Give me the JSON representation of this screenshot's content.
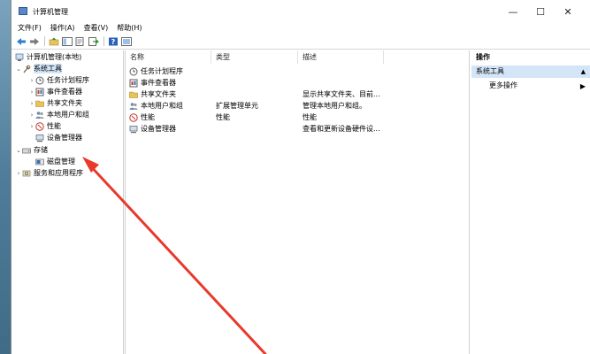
{
  "window": {
    "title": "计算机管理",
    "minimize": "—",
    "maximize": "☐",
    "close": "✕"
  },
  "menu": [
    "文件(F)",
    "操作(A)",
    "查看(V)",
    "帮助(H)"
  ],
  "tree": {
    "root": "计算机管理(本地)",
    "system_tools": "系统工具",
    "task_scheduler": "任务计划程序",
    "event_viewer": "事件查看器",
    "shared_folders": "共享文件夹",
    "local_users": "本地用户和组",
    "performance": "性能",
    "device_manager": "设备管理器",
    "storage": "存储",
    "disk_management": "磁盘管理",
    "services": "服务和应用程序"
  },
  "list": {
    "columns": [
      "名称",
      "类型",
      "描述"
    ],
    "rows": [
      {
        "name": "任务计划程序",
        "type": "",
        "desc": "",
        "icon": "clock-icon"
      },
      {
        "name": "事件查看器",
        "type": "",
        "desc": "",
        "icon": "event-viewer-icon"
      },
      {
        "name": "共享文件夹",
        "type": "",
        "desc": "显示共享文件夹、目前...",
        "icon": "folder-icon"
      },
      {
        "name": "本地用户和组",
        "type": "扩展管理单元",
        "desc": "管理本地用户和组。",
        "icon": "users-icon"
      },
      {
        "name": "性能",
        "type": "性能",
        "desc": "性能",
        "icon": "performance-icon"
      },
      {
        "name": "设备管理器",
        "type": "",
        "desc": "查看和更新设备硬件设...",
        "icon": "device-manager-icon"
      }
    ]
  },
  "actions": {
    "header": "操作",
    "selected": "系统工具",
    "more": "更多操作",
    "up": "▲",
    "more_arrow": "▶"
  },
  "colors": {
    "selection": "#d3e5f7",
    "arrow": "#e8392b"
  }
}
